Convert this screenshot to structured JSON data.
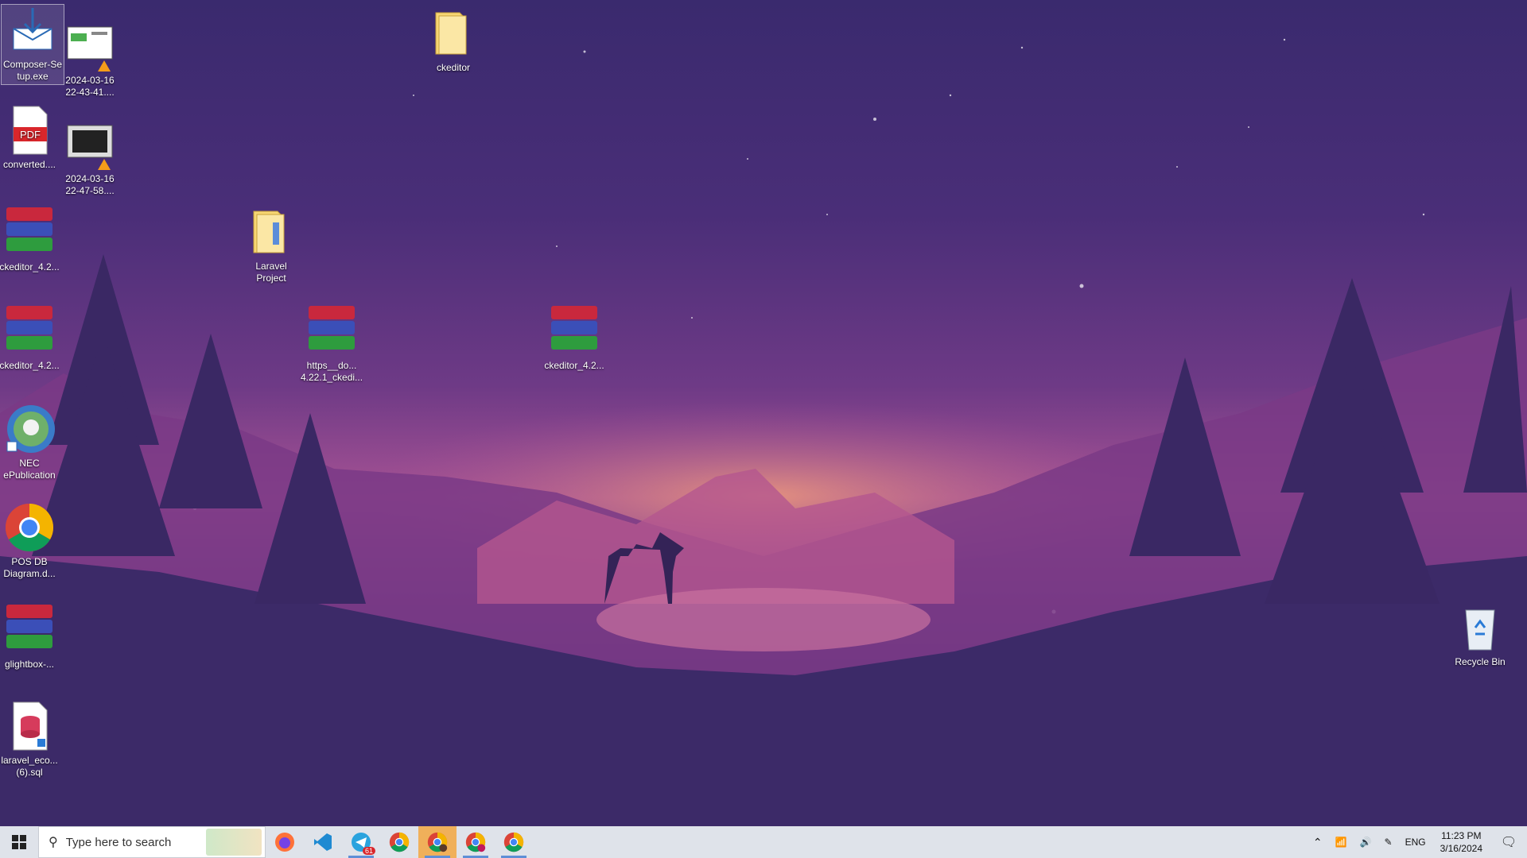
{
  "desktop_icons": [
    {
      "label": "Composer-Setup.exe",
      "display": "Composer-Se\ntup.exe",
      "icon": "installer-icon"
    },
    {
      "label": "2024-03-16 22-43-41....",
      "display": "2024-03-16\n22-43-41....",
      "icon": "video-file-icon"
    },
    {
      "label": "ckeditor",
      "display": "ckeditor",
      "icon": "folder-icon"
    },
    {
      "label": "converted....",
      "display": "converted....",
      "icon": "pdf-icon"
    },
    {
      "label": "2024-03-16 22-47-58....",
      "display": "2024-03-16\n22-47-58....",
      "icon": "video-file-icon"
    },
    {
      "label": "ckeditor_4.2...",
      "display": "ckeditor_4.2...",
      "icon": "winrar-archive-icon"
    },
    {
      "label": "Laravel Project",
      "display": "Laravel\nProject",
      "icon": "folder-icon"
    },
    {
      "label": "ckeditor_4.2...",
      "display": "ckeditor_4.2...",
      "icon": "winrar-archive-icon"
    },
    {
      "label": "https__do... 4.22.1_ckedi...",
      "display": "https__do...\n4.22.1_ckedi...",
      "icon": "winrar-archive-icon"
    },
    {
      "label": "ckeditor_4.2...",
      "display": "ckeditor_4.2...",
      "icon": "winrar-archive-icon"
    },
    {
      "label": "NEC ePublication",
      "display": "NEC\nePublication",
      "icon": "nec-logo-icon"
    },
    {
      "label": "POS DB Diagram.d...",
      "display": "POS DB\nDiagram.d...",
      "icon": "chrome-icon"
    },
    {
      "label": "glightbox-...",
      "display": "glightbox-...",
      "icon": "winrar-archive-icon"
    },
    {
      "label": "laravel_eco... (6).sql",
      "display": "laravel_eco...\n(6).sql",
      "icon": "sql-file-icon"
    },
    {
      "label": "Recycle Bin",
      "display": "Recycle Bin",
      "icon": "recycle-bin-icon"
    }
  ],
  "taskbar": {
    "search_placeholder": "Type here to search",
    "apps": [
      "firefox-icon",
      "vscode-icon",
      "telegram-icon",
      "chrome-icon",
      "chrome-profile-icon",
      "chrome-profile-icon",
      "chrome-icon"
    ],
    "telegram_badge": "61",
    "tray": {
      "language": "ENG",
      "time": "11:23 PM",
      "date": "3/16/2024"
    }
  }
}
